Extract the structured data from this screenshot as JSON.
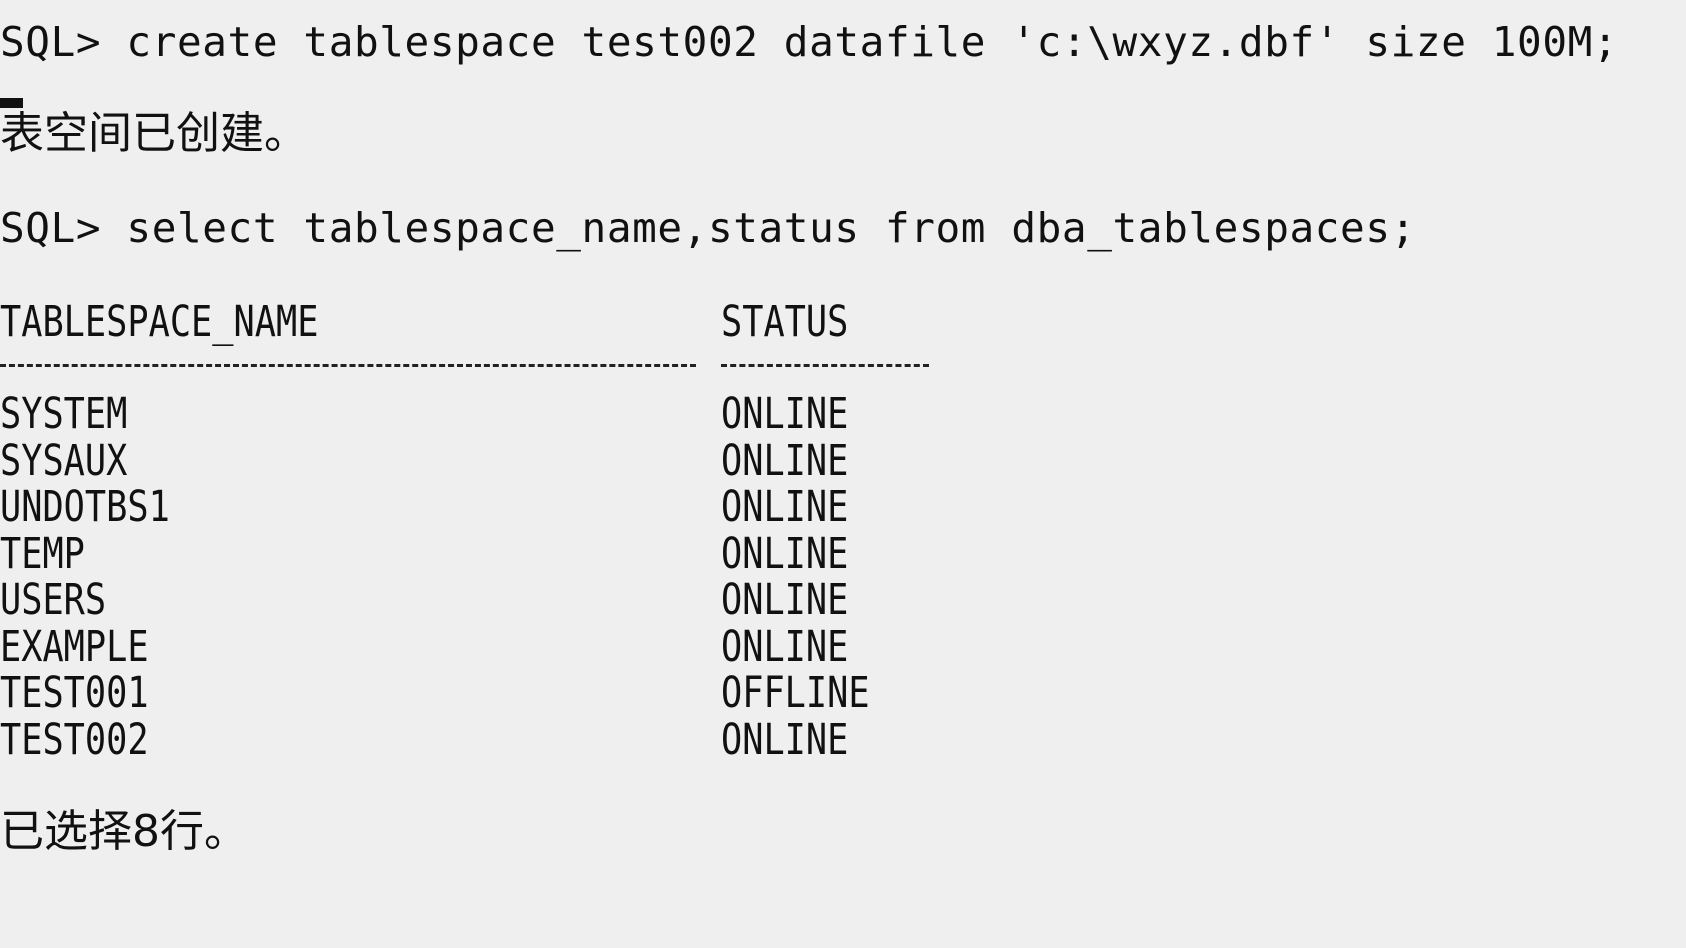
{
  "console": {
    "command1": "SQL> create tablespace test002 datafile 'c:\\wxyz.dbf' size 100M;",
    "result1": "表空间已创建。",
    "command2": "SQL> select tablespace_name,status from dba_tablespaces;",
    "columns": {
      "tablespace_name": "TABLESPACE_NAME",
      "status": "STATUS"
    },
    "rows": [
      {
        "name": "SYSTEM",
        "status": "ONLINE"
      },
      {
        "name": "SYSAUX",
        "status": "ONLINE"
      },
      {
        "name": "UNDOTBS1",
        "status": "ONLINE"
      },
      {
        "name": "TEMP",
        "status": "ONLINE"
      },
      {
        "name": "USERS",
        "status": "ONLINE"
      },
      {
        "name": "EXAMPLE",
        "status": "ONLINE"
      },
      {
        "name": "TEST001",
        "status": "OFFLINE"
      },
      {
        "name": "TEST002",
        "status": "ONLINE"
      }
    ],
    "footer": "已选择8行。"
  }
}
